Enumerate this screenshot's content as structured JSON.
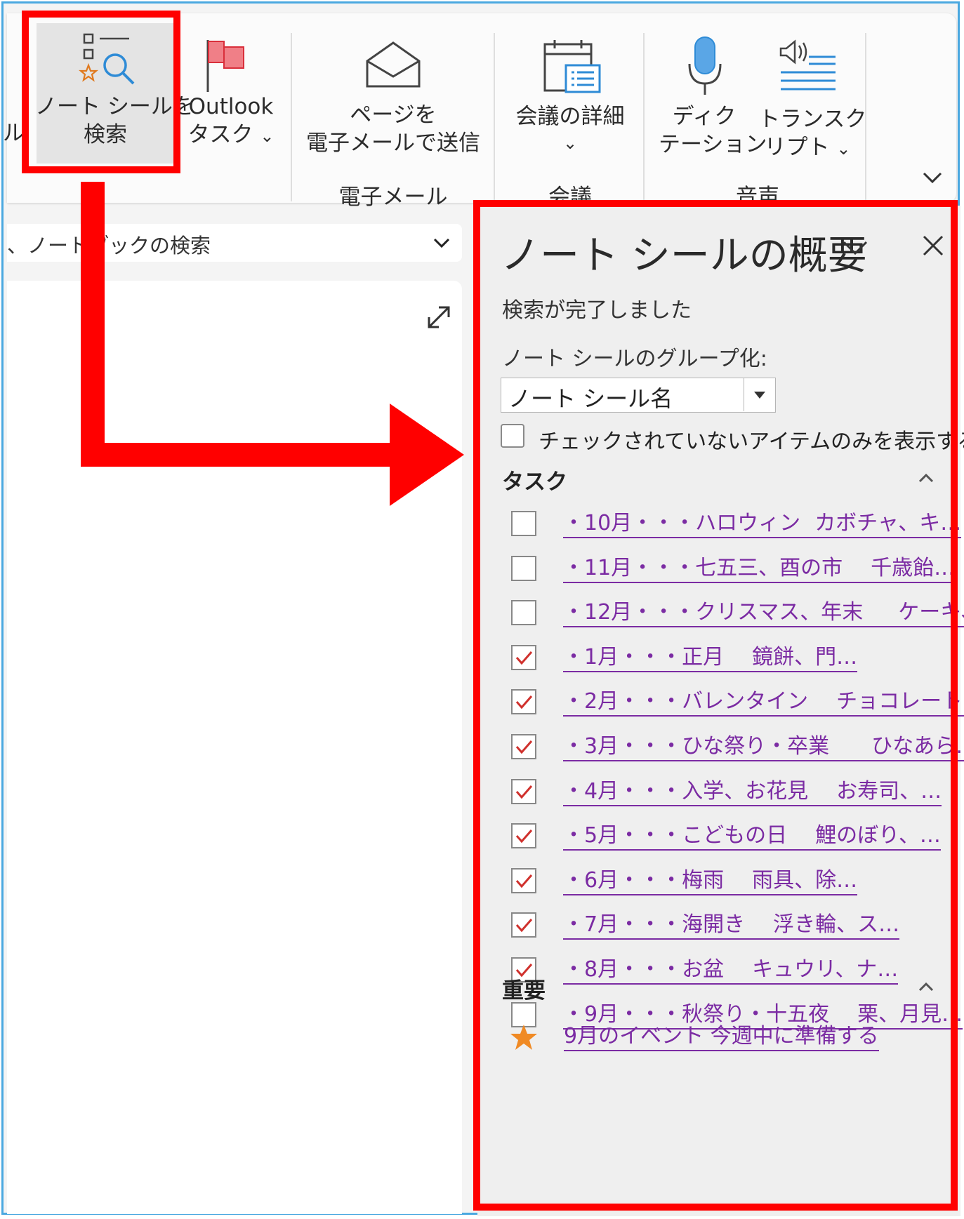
{
  "ribbon": {
    "partial_left_label": "ル",
    "find_tags": {
      "line1": "ノート シールを",
      "line2": "検索"
    },
    "outlook_tasks": {
      "line1": "Outlook",
      "line2": "タスク",
      "caret": "⌄"
    },
    "email_page": {
      "line1": "ページを",
      "line2": "電子メールで送信"
    },
    "meeting_details": {
      "line1": "会議の詳細",
      "caret": "⌄"
    },
    "dictate": {
      "line1": "ディク",
      "line2": "テーション"
    },
    "transcribe": {
      "line1": "トランスク",
      "line2": "リプト",
      "caret": "⌄"
    },
    "groups": {
      "email": "電子メール",
      "meetings": "会議",
      "voice": "音声"
    }
  },
  "notebook_search": {
    "text": "、ノートブックの検索"
  },
  "panel": {
    "title": "ノート シールの概要",
    "status": "検索が完了しました",
    "group_by_label": "ノート シールのグループ化:",
    "group_by_value": "ノート シール名",
    "show_unchecked_label": "チェックされていないアイテムのみを表示する",
    "sections": [
      {
        "name": "タスク",
        "items": [
          {
            "checked": false,
            "month": "・10月・・・ハロウィン",
            "detail": "カボチャ、キ…"
          },
          {
            "checked": false,
            "month": "・11月・・・七五三、酉の市",
            "detail": "千歳飴…"
          },
          {
            "checked": false,
            "month": "・12月・・・クリスマス、年末",
            "detail": "ケーキ、…"
          },
          {
            "checked": true,
            "month": "・1月・・・正月",
            "detail": "鏡餅、門…"
          },
          {
            "checked": true,
            "month": "・2月・・・バレンタイン",
            "detail": "チョコレート…"
          },
          {
            "checked": true,
            "month": "・3月・・・ひな祭り・卒業",
            "detail": "ひなあら…"
          },
          {
            "checked": true,
            "month": "・4月・・・入学、お花見",
            "detail": "お寿司、…"
          },
          {
            "checked": true,
            "month": "・5月・・・こどもの日",
            "detail": "鯉のぼり、…"
          },
          {
            "checked": true,
            "month": "・6月・・・梅雨",
            "detail": "雨具、除…"
          },
          {
            "checked": true,
            "month": "・7月・・・海開き",
            "detail": "浮き輪、ス…"
          },
          {
            "checked": true,
            "month": "・8月・・・お盆",
            "detail": "キュウリ、ナ…"
          },
          {
            "checked": false,
            "month": "・9月・・・秋祭り・十五夜",
            "detail": "栗、月見…"
          }
        ]
      },
      {
        "name": "重要",
        "items": [
          {
            "text": "9月のイベント 今週中に準備する",
            "icon": "star-icon"
          }
        ]
      }
    ]
  },
  "colors": {
    "highlight": "#ff0000",
    "link": "#7b2ba3",
    "check": "#d0312d",
    "star": "#f08a24",
    "frame": "#4aa8e0"
  }
}
